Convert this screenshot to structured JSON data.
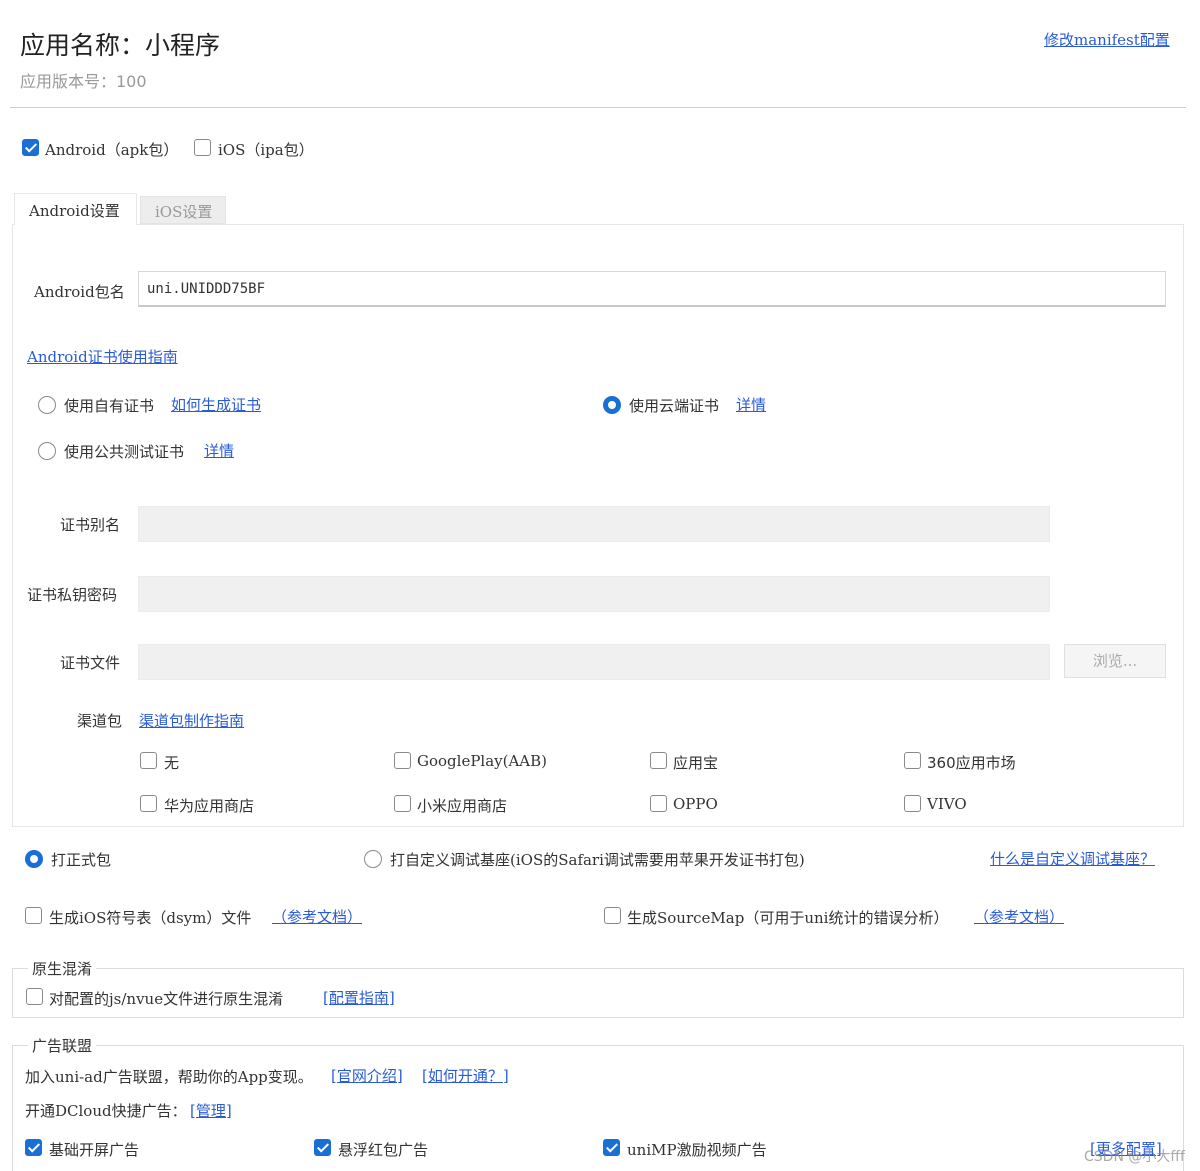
{
  "header": {
    "app_name": "应用名称：小程序",
    "version": "应用版本号：100",
    "edit_manifest_link": "修改manifest配置"
  },
  "platforms": {
    "android_label": "Android（apk包）",
    "android_checked": true,
    "ios_label": "iOS（ipa包）",
    "ios_checked": false
  },
  "tabs": {
    "android": "Android设置",
    "ios": "iOS设置"
  },
  "android": {
    "package_label": "Android包名",
    "package_value": "uni.UNIDDD75BF",
    "cert_guide_link": "Android证书使用指南",
    "cert_options": {
      "own_label": "使用自有证书",
      "own_link": "如何生成证书",
      "cloud_label": "使用云端证书",
      "cloud_link": "详情",
      "public_label": "使用公共测试证书",
      "public_link": "详情",
      "selected": "cloud"
    },
    "alias_label": "证书别名",
    "password_label": "证书私钥密码",
    "file_label": "证书文件",
    "browse_button": "浏览...",
    "channel_label": "渠道包",
    "channel_link": "渠道包制作指南",
    "channels": [
      {
        "label": "无",
        "checked": false
      },
      {
        "label": "GooglePlay(AAB)",
        "checked": false
      },
      {
        "label": "应用宝",
        "checked": false
      },
      {
        "label": "360应用市场",
        "checked": false
      },
      {
        "label": "华为应用商店",
        "checked": false
      },
      {
        "label": "小米应用商店",
        "checked": false
      },
      {
        "label": "OPPO",
        "checked": false
      },
      {
        "label": "VIVO",
        "checked": false
      }
    ]
  },
  "pack_type": {
    "formal_label": "打正式包",
    "custom_label": "打自定义调试基座(iOS的Safari调试需要用苹果开发证书打包)",
    "what_link": "什么是自定义调试基座？",
    "selected": "formal"
  },
  "extras": {
    "dsym_label": "生成iOS符号表（dsym）文件",
    "dsym_link": "（参考文档）",
    "sourcemap_label": "生成SourceMap（可用于uni统计的错误分析）",
    "sourcemap_link": "（参考文档）"
  },
  "obfuscation": {
    "legend": "原生混淆",
    "label": "对配置的js/nvue文件进行原生混淆",
    "link": "[配置指南]"
  },
  "ads": {
    "legend": "广告联盟",
    "join_text": "加入uni-ad广告联盟，帮助你的App变现。",
    "intro_link": "[官网介绍]",
    "how_link": "[如何开通？]",
    "dcloud_text": "开通DCloud快捷广告：",
    "manage_link": "[管理]",
    "options": [
      {
        "label": "基础开屏广告",
        "checked": true
      },
      {
        "label": "悬浮红包广告",
        "checked": true
      },
      {
        "label": "uniMP激励视频广告",
        "checked": true
      }
    ],
    "more_link": "[更多配置]"
  },
  "watermark": "CSDN @小大fff"
}
